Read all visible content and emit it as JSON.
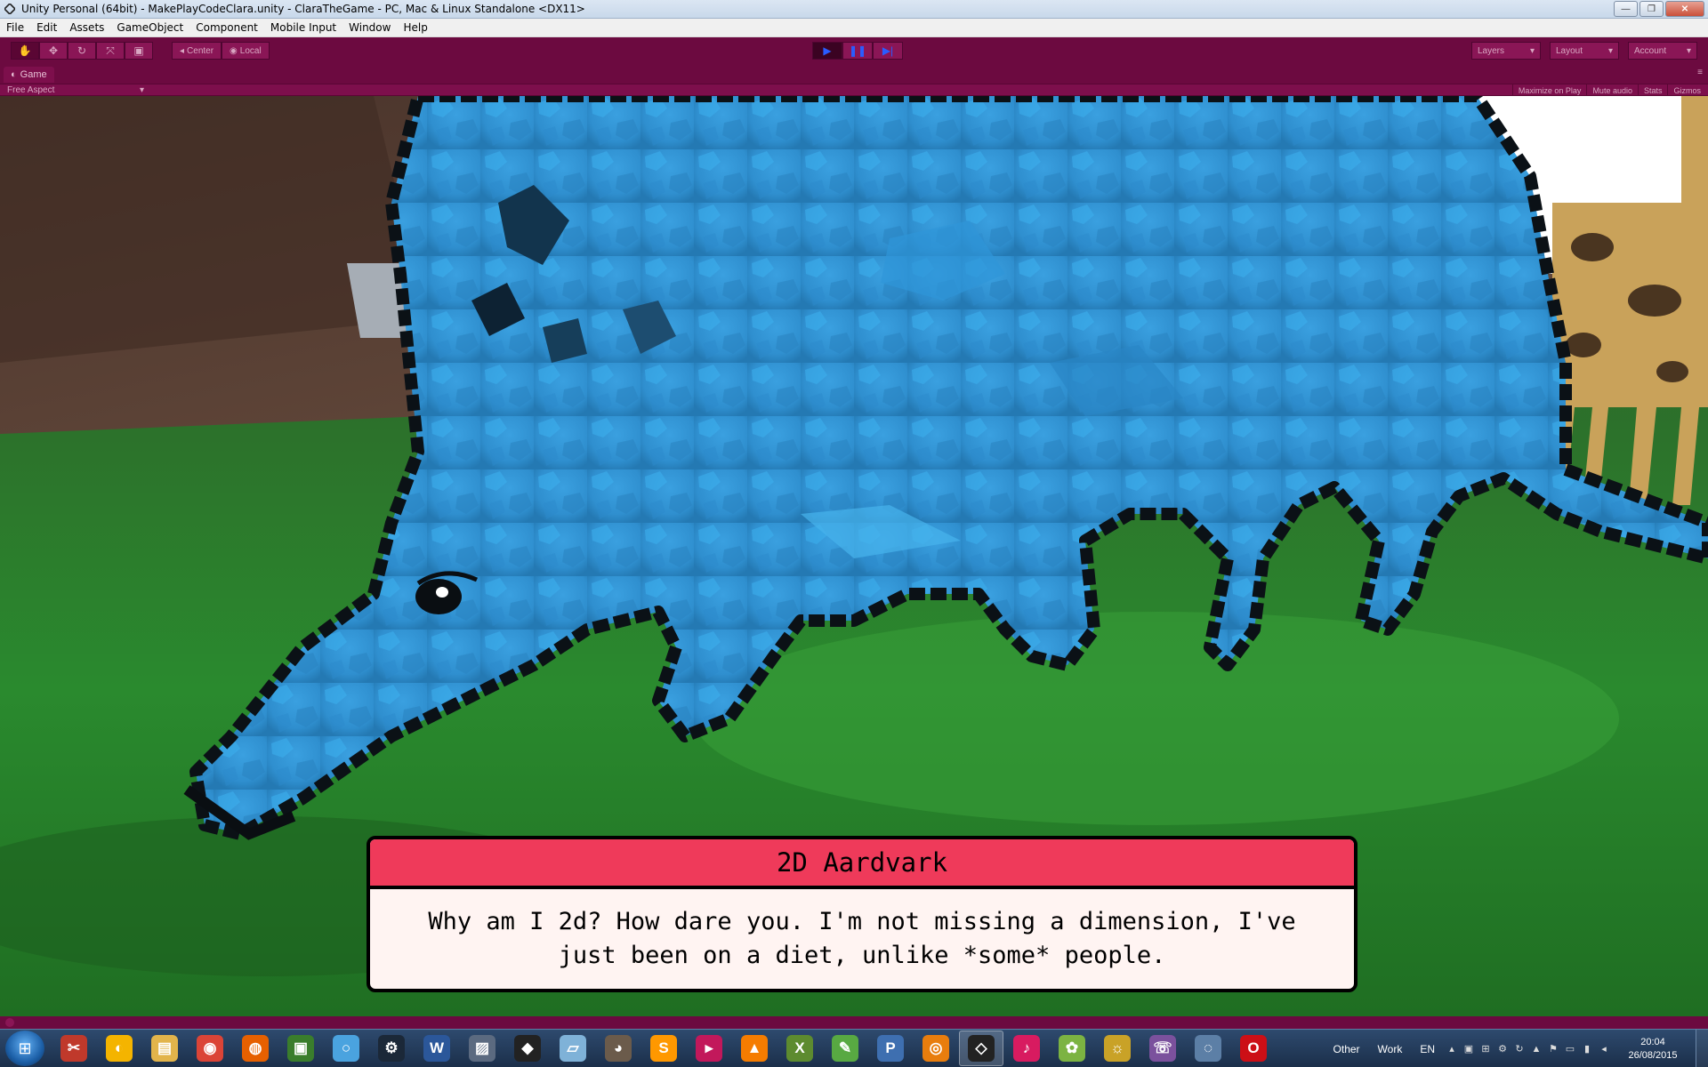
{
  "window": {
    "title": "Unity Personal (64bit) - MakePlayCodeClara.unity - ClaraTheGame - PC, Mac & Linux Standalone <DX11>",
    "buttons": {
      "minimize": "—",
      "maximize": "❐",
      "close": "✕"
    }
  },
  "menu": [
    "File",
    "Edit",
    "Assets",
    "GameObject",
    "Component",
    "Mobile Input",
    "Window",
    "Help"
  ],
  "toolbar": {
    "tools": [
      "hand-icon",
      "move-icon",
      "rotate-icon",
      "scale-icon",
      "rect-icon"
    ],
    "pivot": "Center",
    "space": "Local",
    "play": "▶",
    "pause": "❚❚",
    "step": "▶|",
    "layers": "Layers",
    "layout": "Layout",
    "account": "Account"
  },
  "game_view": {
    "tab": "Game",
    "aspect": "Free Aspect",
    "toggles": [
      "Maximize on Play",
      "Mute audio",
      "Stats",
      "Gizmos"
    ]
  },
  "dialog": {
    "speaker": "2D Aardvark",
    "text": "Why am I 2d? How dare you. I'm not missing a dimension, I've just been on a diet, unlike *some* people."
  },
  "taskbar": {
    "apps": [
      {
        "name": "snipping-tool-icon",
        "glyph": "✂",
        "color": "#c0392b"
      },
      {
        "name": "paint-icon",
        "glyph": "◐",
        "color": "#f4b400"
      },
      {
        "name": "explorer-icon",
        "glyph": "▤",
        "color": "#e2b44b"
      },
      {
        "name": "chrome-icon",
        "glyph": "◉",
        "color": "#db4437"
      },
      {
        "name": "firefox-icon",
        "glyph": "◍",
        "color": "#e66000"
      },
      {
        "name": "terminal-icon",
        "glyph": "▣",
        "color": "#3a7d2c"
      },
      {
        "name": "ring-icon",
        "glyph": "○",
        "color": "#4aa3df"
      },
      {
        "name": "steam-icon",
        "glyph": "⚙",
        "color": "#1b2838"
      },
      {
        "name": "word-icon",
        "glyph": "W",
        "color": "#2b579a"
      },
      {
        "name": "photo-icon",
        "glyph": "▨",
        "color": "#5b6a80"
      },
      {
        "name": "inkscape-icon",
        "glyph": "◆",
        "color": "#222222"
      },
      {
        "name": "tablet-icon",
        "glyph": "▱",
        "color": "#7fb2d8"
      },
      {
        "name": "gimp-icon",
        "glyph": "◕",
        "color": "#6b5b4b"
      },
      {
        "name": "sublime-icon",
        "glyph": "S",
        "color": "#ff9800"
      },
      {
        "name": "media-icon",
        "glyph": "▸",
        "color": "#c2185b"
      },
      {
        "name": "vlc-icon",
        "glyph": "▲",
        "color": "#f57c00"
      },
      {
        "name": "xna-icon",
        "glyph": "X",
        "color": "#5d8b2f"
      },
      {
        "name": "evernote-icon",
        "glyph": "✎",
        "color": "#58a942"
      },
      {
        "name": "pdf-icon",
        "glyph": "P",
        "color": "#3e6fb0"
      },
      {
        "name": "blender-icon",
        "glyph": "◎",
        "color": "#e87d0d"
      },
      {
        "name": "unity-icon",
        "glyph": "◇",
        "color": "#222222"
      },
      {
        "name": "itunes-icon",
        "glyph": "♪",
        "color": "#d81b60"
      },
      {
        "name": "picasa-icon",
        "glyph": "✿",
        "color": "#7cb342"
      },
      {
        "name": "lamp-icon",
        "glyph": "☼",
        "color": "#c9a227"
      },
      {
        "name": "viber-icon",
        "glyph": "☏",
        "color": "#7b519d"
      },
      {
        "name": "network-icon",
        "glyph": "◌",
        "color": "#5c7fa6"
      },
      {
        "name": "opera-icon",
        "glyph": "O",
        "color": "#cc0f16"
      }
    ],
    "toolbars": [
      "Other",
      "Work"
    ],
    "language": "EN",
    "time": "20:04",
    "date": "26/08/2015"
  }
}
